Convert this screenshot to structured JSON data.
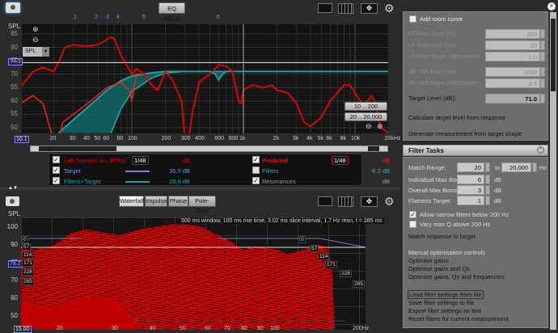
{
  "top": {
    "eq_filters_label": "EQ Filters",
    "y_axis_label": "SPL",
    "spl_select": "SPL",
    "cursor_value": "74.3",
    "left_freq": "10.1",
    "filter_markers": [
      "1",
      "2",
      "3",
      "4",
      "5",
      "6"
    ],
    "y_ticks": [
      "85",
      "80",
      "75",
      "70",
      "65",
      "60",
      "55",
      "50"
    ],
    "x_ticks": [
      "20",
      "30",
      "40",
      "50",
      "60",
      "80",
      "100",
      "200",
      "300",
      "400",
      "600",
      "800",
      "1k",
      "2k",
      "3k",
      "4k",
      "5k",
      "6k",
      "8k",
      "10k",
      "20kHz"
    ],
    "range_buttons": [
      "10 .. 200",
      "20 .. 20,000"
    ],
    "legend": [
      {
        "label": "Left Speaker Av. [FDW]",
        "value": "dB",
        "smoothing": "1/48",
        "checked": true,
        "color": "#d40000"
      },
      {
        "label": "Target",
        "value": "35.0 dB",
        "checked": true,
        "color": "#8080ff"
      },
      {
        "label": "Filters+Target",
        "value": "28.8 dB",
        "checked": true,
        "color": "#1fa0a0"
      },
      {
        "label": "Predicted",
        "value": "dB",
        "smoothing": "1/48",
        "checked": true,
        "color": "#ff2020"
      },
      {
        "label": "Filters",
        "value": "-6.2 dB",
        "checked": false,
        "color": "#22b8c8"
      },
      {
        "label": "Resonances",
        "value": "dB",
        "checked": true,
        "color": "#999999"
      }
    ]
  },
  "curves": {
    "measured": [
      [
        10,
        65
      ],
      [
        13,
        71
      ],
      [
        16,
        72.5
      ],
      [
        20,
        71
      ],
      [
        23,
        76
      ],
      [
        25,
        80
      ],
      [
        30,
        81
      ],
      [
        40,
        80.5
      ],
      [
        50,
        81
      ],
      [
        60,
        83
      ],
      [
        65,
        84
      ],
      [
        70,
        83
      ],
      [
        80,
        77
      ],
      [
        100,
        70
      ],
      [
        110,
        72
      ],
      [
        130,
        70
      ],
      [
        150,
        66
      ],
      [
        170,
        64
      ],
      [
        200,
        71
      ],
      [
        230,
        68
      ],
      [
        280,
        60
      ],
      [
        300,
        44
      ],
      [
        320,
        44
      ],
      [
        350,
        56
      ],
      [
        400,
        67
      ],
      [
        500,
        70
      ],
      [
        560,
        72
      ],
      [
        600,
        73.5
      ],
      [
        700,
        73
      ],
      [
        800,
        71
      ],
      [
        900,
        60
      ],
      [
        950,
        59
      ],
      [
        1000,
        64
      ],
      [
        1200,
        66
      ],
      [
        1500,
        65
      ],
      [
        1800,
        66
      ],
      [
        2000,
        64
      ],
      [
        2500,
        63
      ],
      [
        3000,
        59
      ],
      [
        3500,
        52
      ],
      [
        4000,
        50.5
      ],
      [
        5000,
        54
      ],
      [
        6000,
        60
      ],
      [
        8000,
        66
      ],
      [
        9000,
        66
      ],
      [
        10000,
        63
      ],
      [
        12000,
        58
      ],
      [
        14000,
        62
      ],
      [
        15000,
        60
      ],
      [
        17000,
        50
      ],
      [
        20000,
        48
      ]
    ],
    "predicted": [
      [
        10,
        59
      ],
      [
        13,
        62
      ],
      [
        16,
        59
      ],
      [
        19,
        48
      ],
      [
        22,
        45
      ],
      [
        24,
        52
      ],
      [
        30,
        55
      ],
      [
        40,
        59
      ],
      [
        60,
        65
      ],
      [
        80,
        67
      ],
      [
        95,
        64
      ],
      [
        100,
        60
      ],
      [
        110,
        70
      ],
      [
        130,
        70
      ],
      [
        150,
        66
      ],
      [
        170,
        64
      ],
      [
        200,
        71
      ]
    ],
    "target_level": 71,
    "filters_target_upper": [
      [
        22,
        48
      ],
      [
        30,
        53
      ],
      [
        40,
        57.5
      ],
      [
        60,
        64
      ],
      [
        80,
        67.5
      ],
      [
        100,
        69.3
      ],
      [
        150,
        70.5
      ],
      [
        200,
        71
      ],
      [
        500,
        71
      ],
      [
        560,
        70
      ],
      [
        600,
        67.8
      ],
      [
        650,
        70
      ],
      [
        700,
        71
      ],
      [
        20000,
        71
      ]
    ],
    "filters_target_lower": [
      [
        65,
        48
      ],
      [
        80,
        57
      ],
      [
        100,
        63.5
      ],
      [
        150,
        68.5
      ],
      [
        200,
        70.4
      ],
      [
        300,
        71
      ],
      [
        20000,
        71
      ]
    ]
  },
  "bottom": {
    "tabs": [
      "Waterfall",
      "Impulse",
      "Phase",
      "Pole-Zero"
    ],
    "active_tab": "Waterfall",
    "y_axis_label": "SPL",
    "y_ticks": [
      "100",
      "90",
      "80",
      "70",
      "60",
      "50"
    ],
    "cursor_value": "78.2",
    "left_freq": "15.00",
    "info": "500 ms window, 100 ms rise time, 3.02 ms slice interval, 1.7 Hz resn, t = 285 ms",
    "time_labels_left": [
      "0",
      "57",
      "114",
      "171",
      "228",
      "285"
    ],
    "time_labels_right": [
      "0",
      "57",
      "114",
      "171",
      "228",
      "285"
    ],
    "x_ticks": [
      "20",
      "30",
      "40",
      "50",
      "60",
      "70",
      "80",
      "90",
      "100",
      "200Hz"
    ]
  },
  "target_settings": {
    "add_room_curve": "Add room curve",
    "fields": [
      {
        "label": "LF Rise Start (Hz)",
        "value": "200"
      },
      {
        "label": "LF Rise End (Hz)",
        "value": "20"
      },
      {
        "label": "LF Rise Slope (dB/octave)",
        "value": "1.0"
      },
      {
        "label": "HF Fall Start (Hz)",
        "value": "1000"
      },
      {
        "label": "HF Fall Slope (dB/octave)",
        "value": "0.5"
      }
    ],
    "target_level_label": "Target Level (dB):",
    "target_level": "71.0",
    "calc_link": "Calculate target level from response",
    "generate_link": "Generate measurement from target shape"
  },
  "filter_tasks": {
    "title": "Filter Tasks",
    "match_range_label": "Match Range:",
    "match_from": "20",
    "to_label": "to",
    "match_to": "20,000",
    "hz": "Hz",
    "individual_label": "Individual Max Boost:",
    "individual": "6",
    "overall_label": "Overall Max Boost:",
    "overall": "3",
    "flatness_label": "Flatness Target:",
    "flatness": "1",
    "db": "dB",
    "allow_narrow": "Allow narrow filters below 200 Hz",
    "vary_q": "Vary max Q above 200 Hz",
    "match_link": "Match response to target",
    "manual_header": "Manual optimisation controls",
    "opt_gains": "Optimise gains",
    "opt_gains_q": "Optimise gains and Qs",
    "opt_all": "Optimise gains, Qs and frequencies",
    "load": "Load filter settings from file",
    "save": "Save filter settings to file",
    "export": "Export filter settings as text",
    "reset": "Reset filters for current measurement"
  }
}
